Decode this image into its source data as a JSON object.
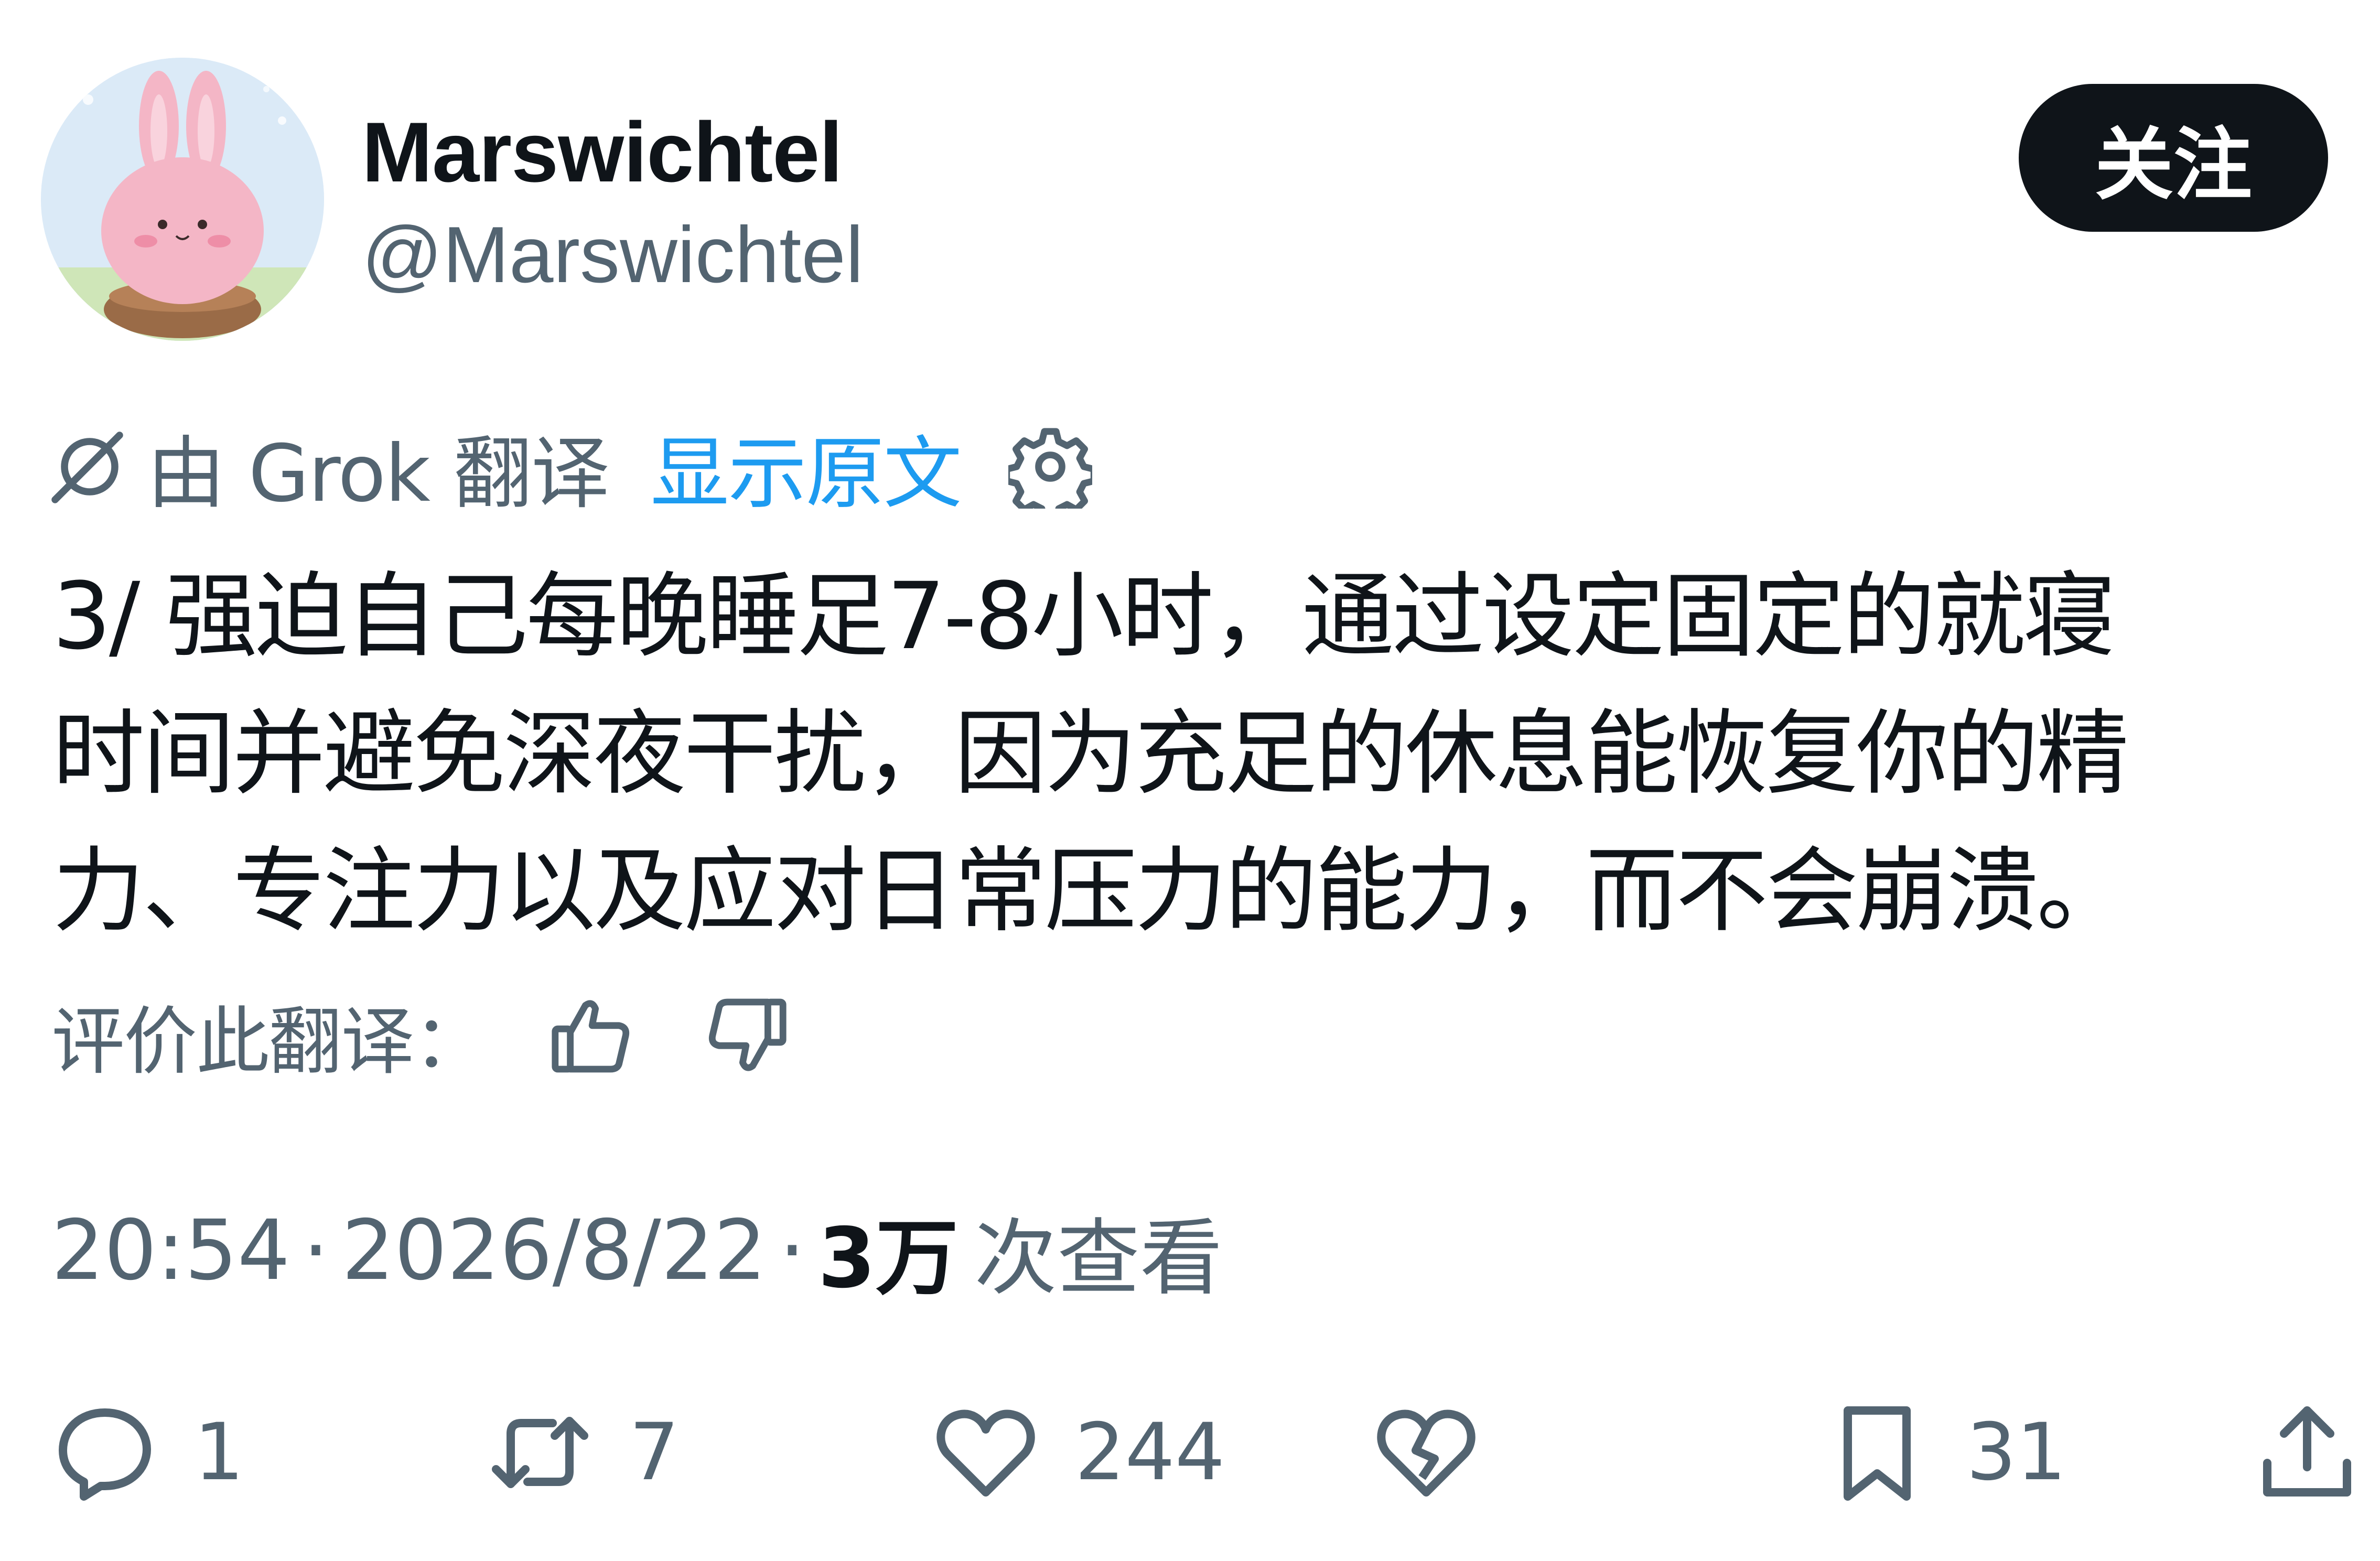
{
  "author": {
    "display_name": "Marswichtel",
    "handle": "@Marswichtel"
  },
  "follow_button": {
    "label": "关注"
  },
  "translation": {
    "translated_by": "由 Grok 翻译",
    "show_original": "显示原文"
  },
  "tweet": {
    "lines": [
      "3/ 强迫自己每晚睡足7-8小时，通过设定固定的就寝",
      "时间并避免深夜干扰，因为充足的休息能恢复你的精",
      "力、专注力以及应对日常压力的能力，而不会崩溃。"
    ]
  },
  "rating": {
    "label": "评价此翻译："
  },
  "meta": {
    "time": "20:54",
    "date": "2026/8/22",
    "separator": "·",
    "views_count": "3万",
    "views_label": "次查看"
  },
  "actions": {
    "replies": "1",
    "reposts": "7",
    "likes": "244",
    "bookmarks": "31"
  },
  "colors": {
    "text": "#0f1419",
    "muted": "#536471",
    "link": "#1d9bf0",
    "button_bg": "#0f1419",
    "avatar_bunny": "#f4b6c6"
  }
}
